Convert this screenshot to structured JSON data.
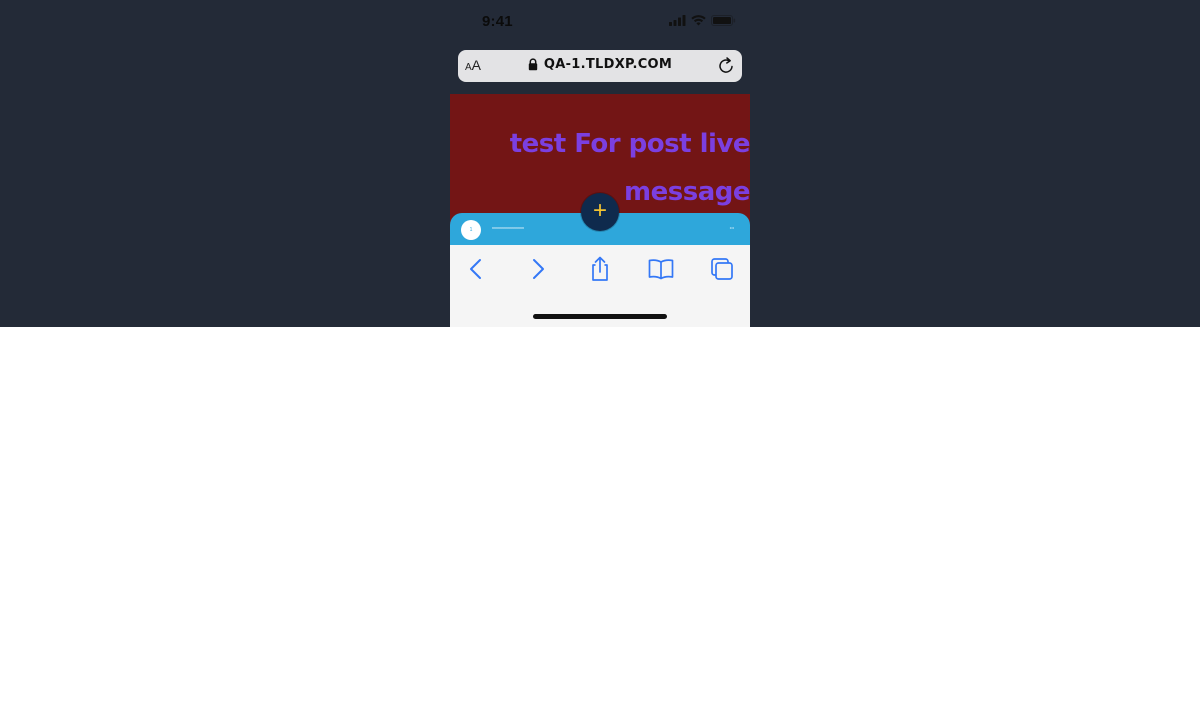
{
  "status_bar": {
    "time": "9:41",
    "icons": [
      "signal-icon",
      "wifi-icon",
      "battery-icon"
    ]
  },
  "address_bar": {
    "text_size_label_small": "A",
    "text_size_label_large": "A",
    "url": "QA-1.TLDXP.COM",
    "icons": [
      "lock-icon",
      "reload-icon"
    ]
  },
  "page": {
    "headline": "test For post live message",
    "add_button_label": "+",
    "mini_bar": {
      "avatar_text": "1",
      "name": "xxxxxxxxxxxxxxxx",
      "menu": "•••"
    }
  },
  "toolbar": {
    "buttons": [
      "back-icon",
      "forward-icon",
      "share-icon",
      "bookmarks-icon",
      "tabs-icon"
    ]
  },
  "colors": {
    "backdrop": "#232a37",
    "page_background": "#731515",
    "headline": "#7b3fe0",
    "mini_bar": "#2ea7db",
    "add_button_bg": "#0f2a4d",
    "add_button_fg": "#f1c232",
    "toolbar_icons": "#3478f6"
  }
}
